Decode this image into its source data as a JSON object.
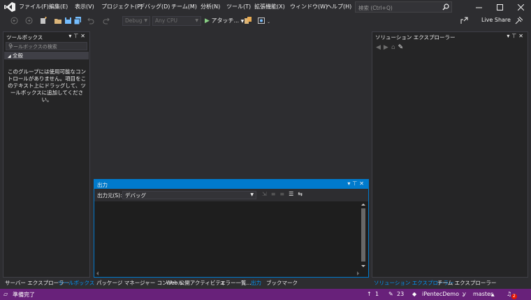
{
  "menu": [
    "ファイル(F)",
    "編集(E)",
    "表示(V)",
    "プロジェクト(P)",
    "デバッグ(D)",
    "チーム(M)",
    "分析(N)",
    "ツール(T)",
    "拡張機能(X)",
    "ウィンドウ(W)",
    "ヘルプ(H)"
  ],
  "search": {
    "placeholder": "検索 (Ctrl+Q)"
  },
  "toolbar": {
    "config": "Debug",
    "platform": "Any CPU",
    "attach": "アタッチ...",
    "live_share": "Live Share"
  },
  "toolbox": {
    "title": "ツールボックス",
    "search_placeholder": "ツールボックスの検索",
    "group": "全般",
    "empty_message": "このグループには使用可能なコントロールがありません。項目をこのテキスト上にドラッグして、ツールボックスに追加してください。"
  },
  "solution_explorer": {
    "title": "ソリューション エクスプローラー"
  },
  "output": {
    "title": "出力",
    "source_label": "出力元(S):",
    "source_value": "デバッグ"
  },
  "left_tabs": [
    "サーバー エクスプローラー",
    "ツールボックス"
  ],
  "center_tabs": [
    "パッケージ マネージャー コンソール",
    "Web 公開アクティビティ",
    "エラー一覧...",
    "出力",
    "ブックマーク"
  ],
  "right_tabs": [
    "ソリューション エクスプローラー",
    "チーム エクスプローラー"
  ],
  "status": {
    "ready": "準備完了",
    "up_count": "1",
    "edit_count": "23",
    "repo": "iPentecDemo",
    "branch": "master",
    "notifications": "2"
  },
  "colors": {
    "accent": "#007acc",
    "status_bar": "#68217a",
    "active_tab": "#0097fb"
  }
}
